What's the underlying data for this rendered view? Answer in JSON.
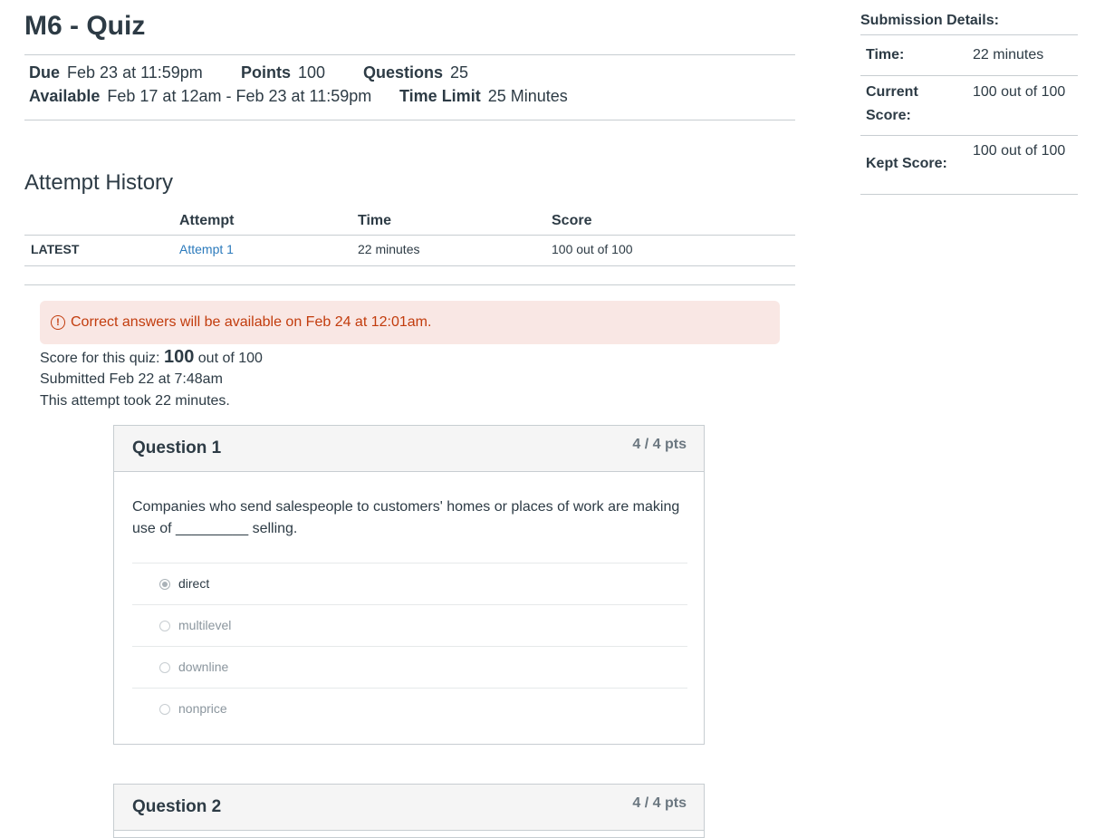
{
  "page": {
    "title": "M6 - Quiz"
  },
  "meta": {
    "due_label": "Due",
    "due_value": "Feb 23 at 11:59pm",
    "points_label": "Points",
    "points_value": "100",
    "questions_label": "Questions",
    "questions_value": "25",
    "available_label": "Available",
    "available_value": "Feb 17 at 12am - Feb 23 at 11:59pm",
    "time_limit_label": "Time Limit",
    "time_limit_value": "25 Minutes"
  },
  "history": {
    "title": "Attempt History",
    "headers": {
      "attempt": "Attempt",
      "time": "Time",
      "score": "Score"
    },
    "rows": [
      {
        "tag": "LATEST",
        "attempt": "Attempt 1",
        "time": "22 minutes",
        "score": "100 out of 100"
      }
    ]
  },
  "result": {
    "alert_icon": "!",
    "alert": "Correct answers will be available on Feb 24 at 12:01am.",
    "score_prefix": "Score for this quiz: ",
    "score_value": "100",
    "score_suffix": " out of 100",
    "submitted": "Submitted Feb 22 at 7:48am",
    "duration": "This attempt took 22 minutes."
  },
  "questions": [
    {
      "name": "Question 1",
      "points": "4 / 4 pts",
      "text": "Companies who send salespeople to customers' homes or places of work are making use of _________ selling.",
      "answers": [
        {
          "label": "direct",
          "selected": true
        },
        {
          "label": "multilevel",
          "selected": false
        },
        {
          "label": "downline",
          "selected": false
        },
        {
          "label": "nonprice",
          "selected": false
        }
      ]
    },
    {
      "name": "Question 2",
      "points": "4 / 4 pts"
    }
  ],
  "sidebar": {
    "title": "Submission Details:",
    "time_label": "Time:",
    "time_value": "22 minutes",
    "current_label": "Current Score:",
    "current_value": "100 out of 100",
    "kept_label": "Kept Score:",
    "kept_value": "100 out of 100"
  },
  "colors": {
    "text": "#2d3b45",
    "link": "#2b7abc",
    "alert_bg": "#f9e7e4",
    "alert_text": "#c23c0d",
    "border": "#c7cdd1",
    "header_bg": "#f5f5f5",
    "muted": "#8b969e"
  }
}
